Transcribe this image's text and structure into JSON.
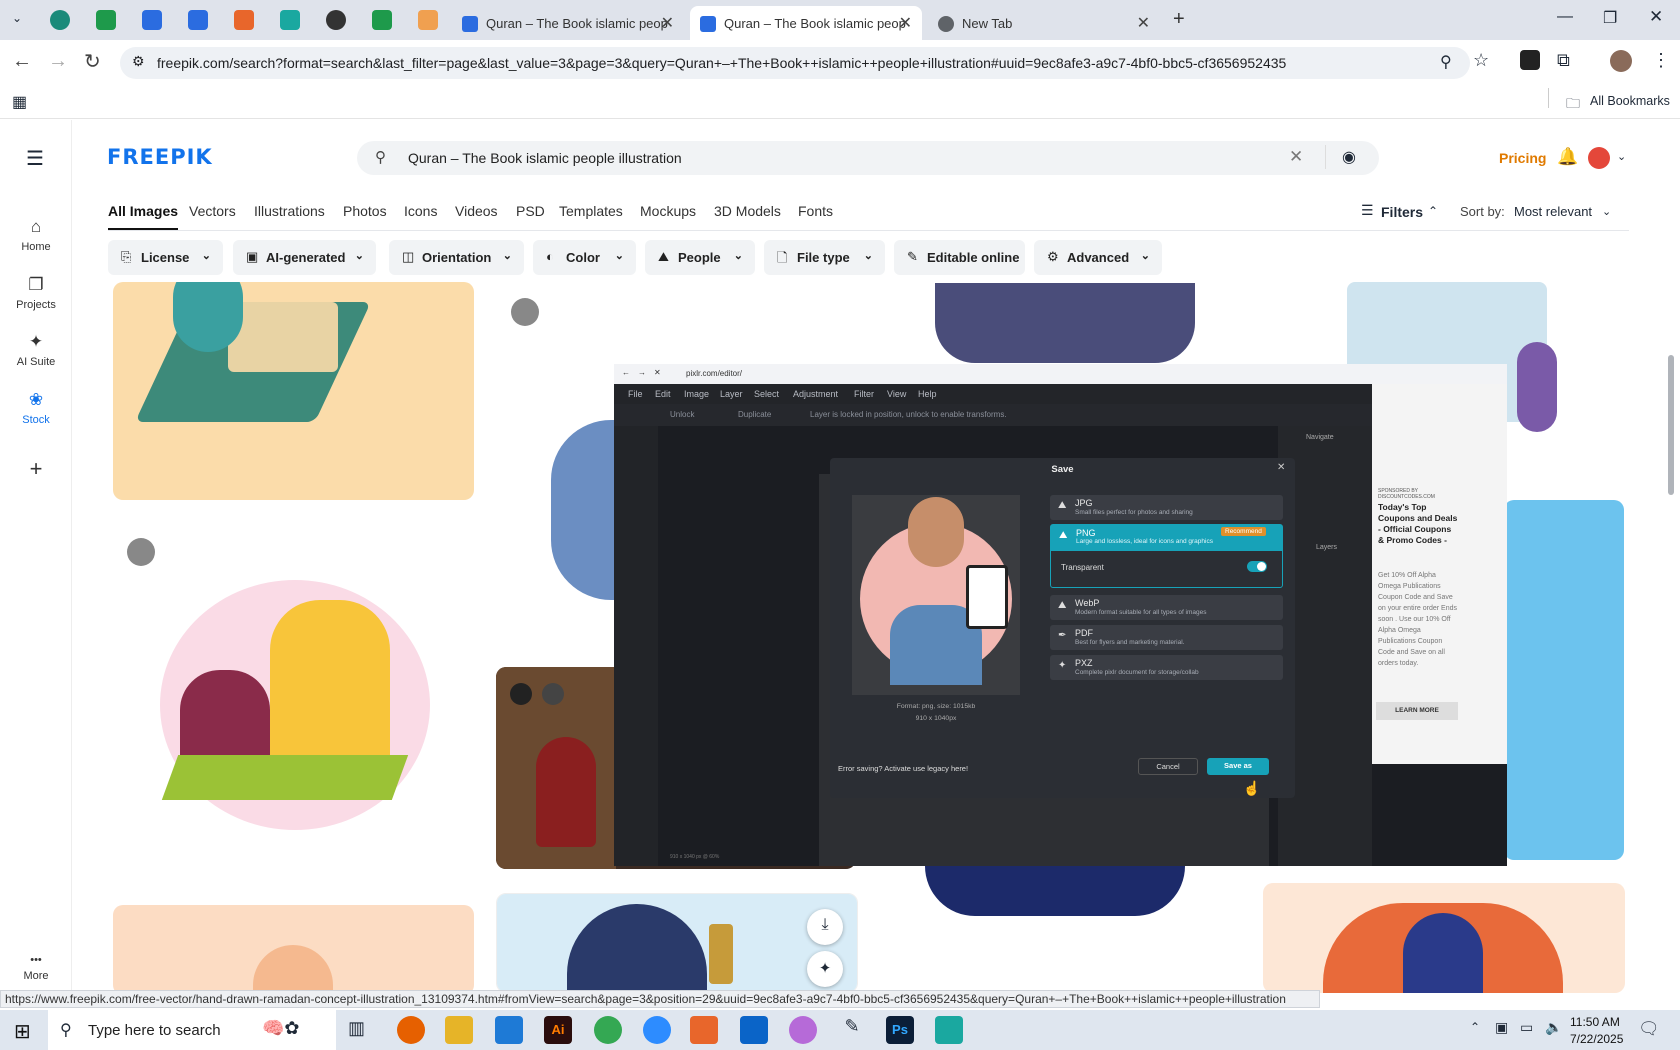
{
  "browser": {
    "tabs": [
      {
        "title": "Quran – The Book islamic peop",
        "active": false
      },
      {
        "title": "Quran – The Book islamic peop",
        "active": true
      },
      {
        "title": "New Tab",
        "active": false
      }
    ],
    "url": "freepik.com/search?format=search&last_filter=page&last_value=3&page=3&query=Quran+–+The+Book++islamic++people+illustration#uuid=9ec8afe3-a9c7-4bf0-bbc5-cf3656952435",
    "bookmarks_label": "All Bookmarks",
    "status_url": "https://www.freepik.com/free-vector/hand-drawn-ramadan-concept-illustration_13109374.htm#fromView=search&page=3&position=29&uuid=9ec8afe3-a9c7-4bf0-bbc5-cf3656952435&query=Quran+–+The+Book++islamic++people+illustration"
  },
  "freepik": {
    "logo": "FREEPIK",
    "search_value": "Quran – The Book  islamic  people illustration",
    "pricing": "Pricing",
    "sidebar": [
      {
        "label": "Home",
        "icon": "home-icon",
        "glyph": "⌂"
      },
      {
        "label": "Projects",
        "icon": "projects-icon",
        "glyph": "❐"
      },
      {
        "label": "AI Suite",
        "icon": "ai-suite-icon",
        "glyph": "✦"
      },
      {
        "label": "Stock",
        "icon": "stock-icon",
        "glyph": "❀"
      },
      {
        "label": "",
        "icon": "plus-icon",
        "glyph": "+"
      },
      {
        "label": "More",
        "icon": "more-icon",
        "glyph": "•••"
      }
    ],
    "categories": [
      "All Images",
      "Vectors",
      "Illustrations",
      "Photos",
      "Icons",
      "Videos",
      "PSD",
      "Templates",
      "Mockups",
      "3D Models",
      "Fonts"
    ],
    "filters_label": "Filters",
    "sort_label": "Sort by:",
    "sort_value": "Most relevant",
    "filter_chips": [
      "License",
      "AI-generated",
      "Orientation",
      "Color",
      "People",
      "File type",
      "Editable online",
      "Advanced"
    ]
  },
  "pixlr": {
    "url": "pixlr.com/editor/",
    "menu": [
      "File",
      "Edit",
      "Image",
      "Layer",
      "Select",
      "Adjustment",
      "Filter",
      "View",
      "Help"
    ],
    "options": [
      "Unlock",
      "Duplicate",
      "Layer is locked in position, unlock to enable transforms."
    ],
    "navigate": "Navigate",
    "layers": "Layers",
    "ad": {
      "sponsor": "SPONSORED BY DISCOUNTCODES.COM",
      "title": "Today's Top Coupons and Deals - Official Coupons & Promo Codes -",
      "body": "Get 10% Off Alpha Omega Publications Coupon Code and Save on your entire order Ends soon . Use our 10% Off Alpha Omega Publications Coupon Code and Save on all orders today.",
      "cta": "LEARN MORE"
    },
    "dialog": {
      "title": "Save",
      "format_info": "Format: png, size: 1015kb",
      "dims": "910 x 1040px",
      "formats": [
        {
          "name": "JPG",
          "desc": "Small files perfect for photos and sharing"
        },
        {
          "name": "PNG",
          "desc": "Large and lossless, ideal for icons and graphics",
          "badge": "Recommend"
        },
        {
          "name": "WebP",
          "desc": "Modern format suitable for all types of images"
        },
        {
          "name": "PDF",
          "desc": "Best for flyers and marketing material."
        },
        {
          "name": "PXZ",
          "desc": "Complete pixlr document for storage/collab"
        }
      ],
      "transparent_label": "Transparent",
      "transparent_on": true,
      "error_text": "Error saving? Activate use legacy here!",
      "cancel": "Cancel",
      "save": "Save as"
    },
    "footer": "910 x 1040 px @ 60%"
  },
  "taskbar": {
    "search_placeholder": "Type here to search",
    "time": "11:50 AM",
    "date": "7/22/2025"
  },
  "colors": {
    "accent": "#1273eb",
    "pricing": "#e07a00",
    "pixlr_teal": "#17a2b8"
  }
}
